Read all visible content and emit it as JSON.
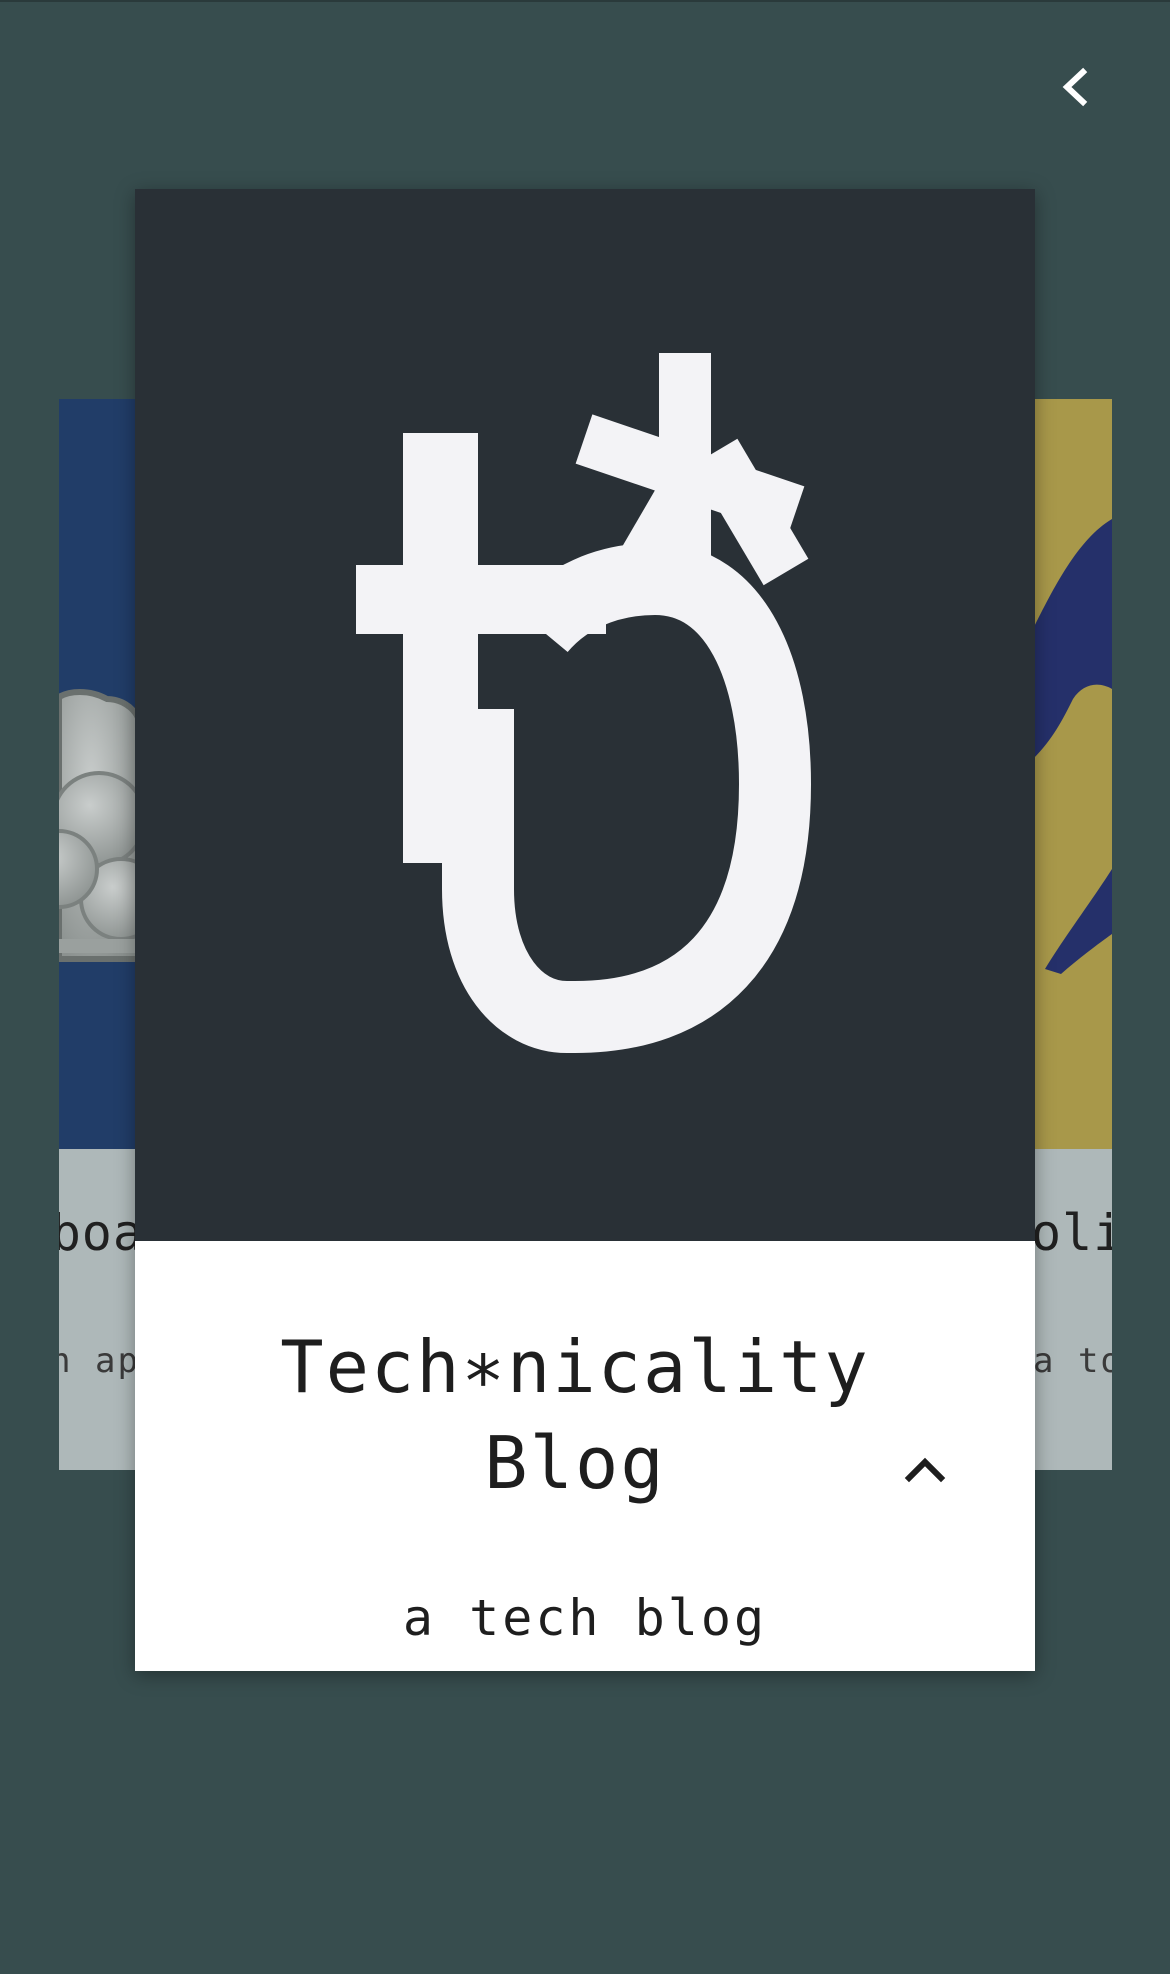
{
  "nav": {
    "back_icon": "chevron-left-icon"
  },
  "colors": {
    "background": "#374d4e",
    "card_dark": "#293036",
    "logo_white": "#f3f3f6",
    "left_card_accent": "#213d68",
    "right_card_accent": "#a8984a",
    "side_card_body": "#aeb8b9"
  },
  "cards": {
    "left": {
      "title_fragment": "boa",
      "desc_fragment": "n ap"
    },
    "main": {
      "logo_icon": "technicality-logo-icon",
      "title": "Tech∗nicality Blog",
      "description": "a tech blog",
      "expand_icon": "chevron-up-icon"
    },
    "right": {
      "title_fragment": "oli",
      "desc_fragment": "a to"
    }
  }
}
